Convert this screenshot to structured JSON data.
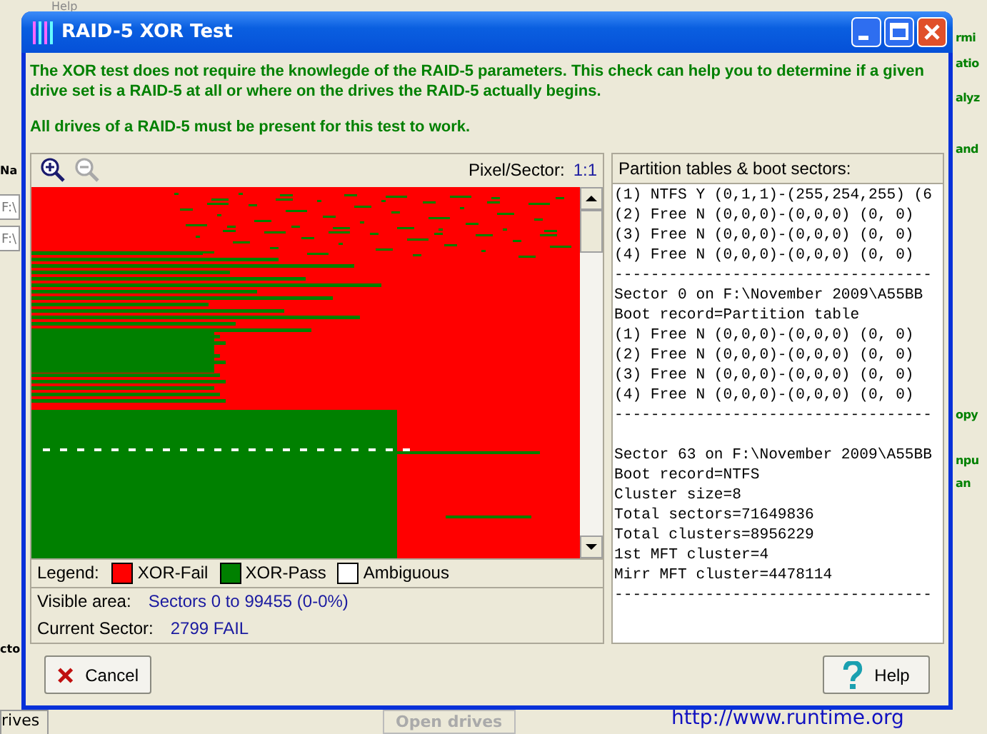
{
  "background": {
    "menu": "Help",
    "name_header": "Na",
    "drive_fields": [
      "F:\\",
      "F:\\"
    ],
    "sector_label": "cto",
    "tab": "rives",
    "open_button": "Open drives",
    "link": "http://www.runtime.org",
    "right_texts": [
      "rmi",
      "atio",
      "alyz",
      "and",
      "opy",
      "npu",
      "an"
    ]
  },
  "window": {
    "title": "RAID-5 XOR Test"
  },
  "intro": [
    "The XOR test does not require the knowlegde of the RAID-5 parameters. This check can help you to determine if a given drive set is a RAID-5 at all or where on the drives the RAID-5 actually begins.",
    "All drives of a RAID-5 must be present for this test to work."
  ],
  "zoom_buttons": [
    {
      "kind": "zoom-in",
      "disabled": false
    },
    {
      "kind": "zoom-out",
      "disabled": true
    }
  ],
  "pixel_sector": {
    "label": "Pixel/Sector:",
    "value": "1:1"
  },
  "legend": {
    "label": "Legend:",
    "items": [
      {
        "label": "XOR-Fail",
        "color": "#ff0000"
      },
      {
        "label": "XOR-Pass",
        "color": "#008000"
      },
      {
        "label": "Ambiguous",
        "color": "#ffffff"
      }
    ]
  },
  "visible_area": {
    "label": "Visible area:",
    "value": "Sectors 0 to 99455 (0-0%)"
  },
  "current_sector": {
    "label": "Current Sector:",
    "value": "2799 FAIL"
  },
  "partition_panel": {
    "title": "Partition tables & boot sectors:",
    "sections": [
      [
        "(1) NTFS Y (0,1,1)-(255,254,255) (6",
        "(2) Free N (0,0,0)-(0,0,0) (0, 0)",
        "(3) Free N (0,0,0)-(0,0,0) (0, 0)",
        "(4) Free N (0,0,0)-(0,0,0) (0, 0)",
        "-----------------------------------"
      ],
      [
        "Sector 0 on F:\\November 2009\\A55BB",
        "Boot record=Partition table",
        "(1) Free N (0,0,0)-(0,0,0) (0, 0)",
        "(2) Free N (0,0,0)-(0,0,0) (0, 0)",
        "(3) Free N (0,0,0)-(0,0,0) (0, 0)",
        "(4) Free N (0,0,0)-(0,0,0) (0, 0)",
        "-----------------------------------"
      ],
      [
        "Sector 63 on F:\\November 2009\\A55BB",
        "Boot record=NTFS",
        "Cluster size=8",
        "Total sectors=71649836",
        "Total clusters=8956229",
        "1st MFT cluster=4",
        "Mirr MFT cluster=4478114",
        "-----------------------------------"
      ]
    ]
  },
  "buttons": [
    {
      "kind": "cancel",
      "label": "Cancel"
    },
    {
      "kind": "help",
      "label": "Help"
    }
  ]
}
